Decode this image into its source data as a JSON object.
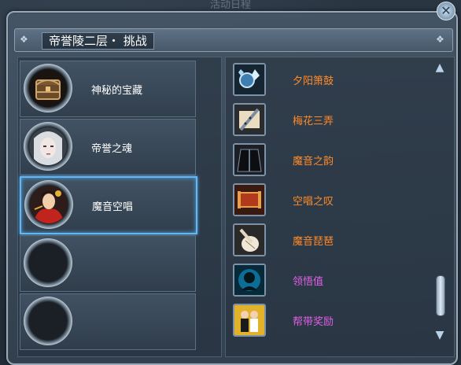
{
  "window": {
    "top_title": "活动日程",
    "close_label": "✕",
    "header_title": "帝誉陵二层・ 挑战"
  },
  "slots": [
    {
      "label": "神秘的宝藏",
      "portrait": "treasure-chest",
      "selected": false
    },
    {
      "label": "帝誉之魂",
      "portrait": "pale-spirit",
      "selected": false
    },
    {
      "label": "魔音空唱",
      "portrait": "red-dancer",
      "selected": true
    },
    {
      "label": "",
      "portrait": "empty",
      "selected": false
    },
    {
      "label": "",
      "portrait": "empty",
      "selected": false
    }
  ],
  "rewards": [
    {
      "label": "夕阳箫鼓",
      "color": "#ff8a2a",
      "icon": "drum-crystals-icon"
    },
    {
      "label": "梅花三弄",
      "color": "#ff8a2a",
      "icon": "flute-scroll-icon"
    },
    {
      "label": "魔音之韵",
      "color": "#ff8a2a",
      "icon": "dark-robe-icon"
    },
    {
      "label": "空唱之叹",
      "color": "#ff8a2a",
      "icon": "red-scroll-icon"
    },
    {
      "label": "魔音琵琶",
      "color": "#ff8a2a",
      "icon": "pipa-instrument-icon"
    },
    {
      "label": "领悟值",
      "color": "#e05fe6",
      "icon": "blue-head-icon"
    },
    {
      "label": "帮带奖励",
      "color": "#e05fe6",
      "icon": "duo-portrait-icon"
    }
  ],
  "colors": {
    "accent_blue": "#66b7ef",
    "reward_orange": "#ff8a2a",
    "reward_pink": "#e05fe6"
  }
}
